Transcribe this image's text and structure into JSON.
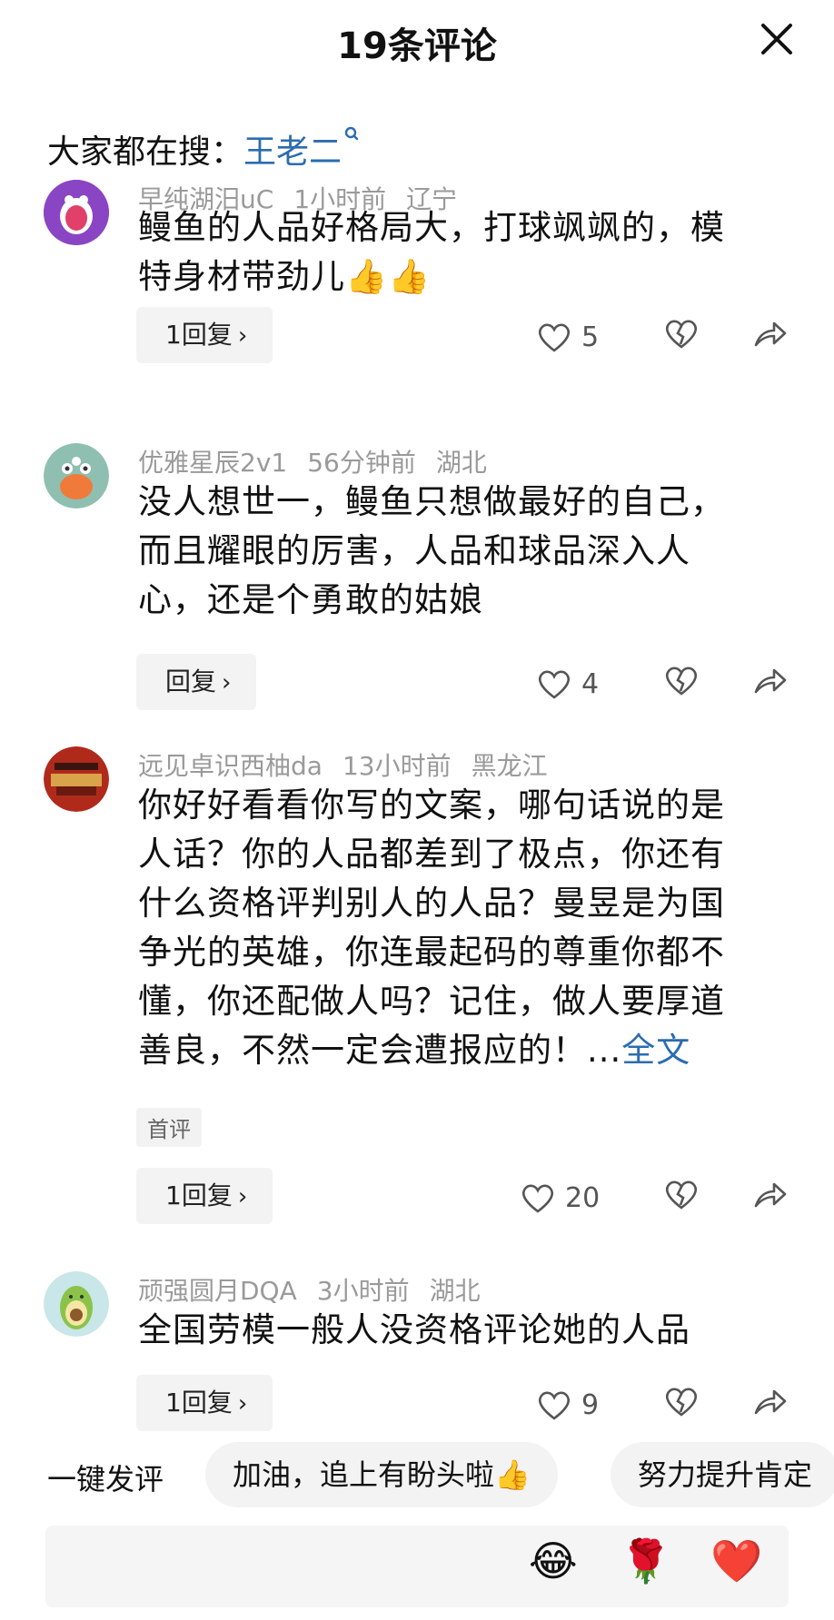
{
  "header": {
    "title": "19条评论"
  },
  "search": {
    "label": "大家都在搜：",
    "keyword": "王老二"
  },
  "comments": [
    {
      "user": "早纯湖汨uC",
      "time": "1小时前",
      "location": "辽宁",
      "text_lines": [
        "鳗鱼的人品好格局大，打球飒飒的，模",
        "特身材带劲儿👍👍"
      ],
      "reply": "1回复",
      "likes": "5"
    },
    {
      "user": "优雅星辰2v1",
      "time": "56分钟前",
      "location": "湖北",
      "text_lines": [
        "没人想世一，鳗鱼只想做最好的自己，",
        "而且耀眼的厉害，人品和球品深入人",
        "心，还是个勇敢的姑娘"
      ],
      "reply": "回复",
      "likes": "4"
    },
    {
      "user": "远见卓识西柚da",
      "time": "13小时前",
      "location": "黑龙江",
      "text_lines": [
        "你好好看看你写的文案，哪句话说的是",
        "人话？你的人品都差到了极点，你还有",
        "什么资格评判别人的人品？曼昱是为国",
        "争光的英雄，你连最起码的尊重你都不",
        "懂，你还配做人吗？记住，做人要厚道",
        "善良，不然一定会遭报应的！..."
      ],
      "more": "全文",
      "badge": "首评",
      "reply": "1回复",
      "likes": "20"
    },
    {
      "user": "顽强圆月DQA",
      "time": "3小时前",
      "location": "湖北",
      "text_lines": [
        "全国劳模一般人没资格评论她的人品"
      ],
      "reply": "1回复",
      "likes": "9"
    }
  ],
  "quick": {
    "label": "一键发评",
    "chips": [
      "加油，追上有盼头啦👍",
      "努力提升肯定"
    ]
  },
  "input": {
    "emojis": [
      "😂",
      "🌹",
      "❤️"
    ]
  }
}
